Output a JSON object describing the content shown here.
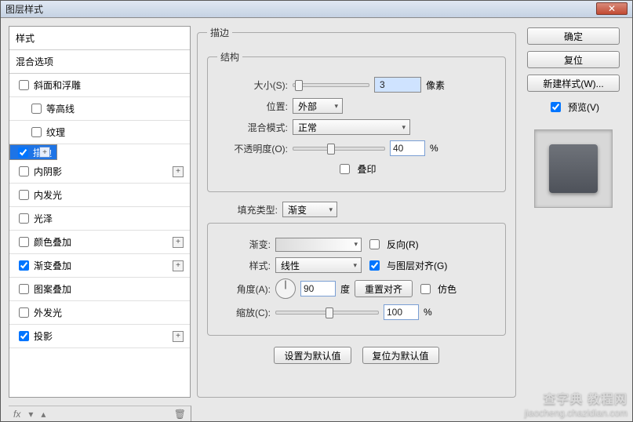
{
  "window": {
    "title": "图层样式",
    "close": "✕"
  },
  "left": {
    "styles_header": "样式",
    "blend_header": "混合选项",
    "items": [
      {
        "label": "斜面和浮雕",
        "checked": false,
        "plus": false,
        "sub": false
      },
      {
        "label": "等高线",
        "checked": false,
        "plus": false,
        "sub": true
      },
      {
        "label": "纹理",
        "checked": false,
        "plus": false,
        "sub": true
      },
      {
        "label": "描边",
        "checked": true,
        "plus": true,
        "sub": false,
        "selected": true
      },
      {
        "label": "内阴影",
        "checked": false,
        "plus": true,
        "sub": false
      },
      {
        "label": "内发光",
        "checked": false,
        "plus": false,
        "sub": false
      },
      {
        "label": "光泽",
        "checked": false,
        "plus": false,
        "sub": false
      },
      {
        "label": "颜色叠加",
        "checked": false,
        "plus": true,
        "sub": false
      },
      {
        "label": "渐变叠加",
        "checked": true,
        "plus": true,
        "sub": false
      },
      {
        "label": "图案叠加",
        "checked": false,
        "plus": false,
        "sub": false
      },
      {
        "label": "外发光",
        "checked": false,
        "plus": false,
        "sub": false
      },
      {
        "label": "投影",
        "checked": true,
        "plus": true,
        "sub": false
      }
    ],
    "fx": "fx"
  },
  "center": {
    "outer_legend": "描边",
    "struct_legend": "结构",
    "size_label": "大小(S):",
    "size_value": "3",
    "size_unit": "像素",
    "pos_label": "位置:",
    "pos_value": "外部",
    "blend_label": "混合模式:",
    "blend_value": "正常",
    "opacity_label": "不透明度(O):",
    "opacity_value": "40",
    "opacity_unit": "%",
    "overprint_label": "叠印",
    "fill_label": "填充类型:",
    "fill_value": "渐变",
    "grad_label": "渐变:",
    "reverse_label": "反向(R)",
    "style_label": "样式:",
    "style_value": "线性",
    "align_label": "与图层对齐(G)",
    "align_checked": true,
    "angle_label": "角度(A):",
    "angle_value": "90",
    "angle_unit": "度",
    "reset_align": "重置对齐",
    "dither_label": "仿色",
    "scale_label": "缩放(C):",
    "scale_value": "100",
    "scale_unit": "%",
    "make_default": "设置为默认值",
    "reset_default": "复位为默认值"
  },
  "right": {
    "ok": "确定",
    "reset": "复位",
    "new_style": "新建样式(W)...",
    "preview_label": "预览(V)",
    "preview_checked": true
  },
  "watermark": {
    "l1": "查字典 教程网",
    "l2": "jiaocheng.chazidian.com"
  }
}
